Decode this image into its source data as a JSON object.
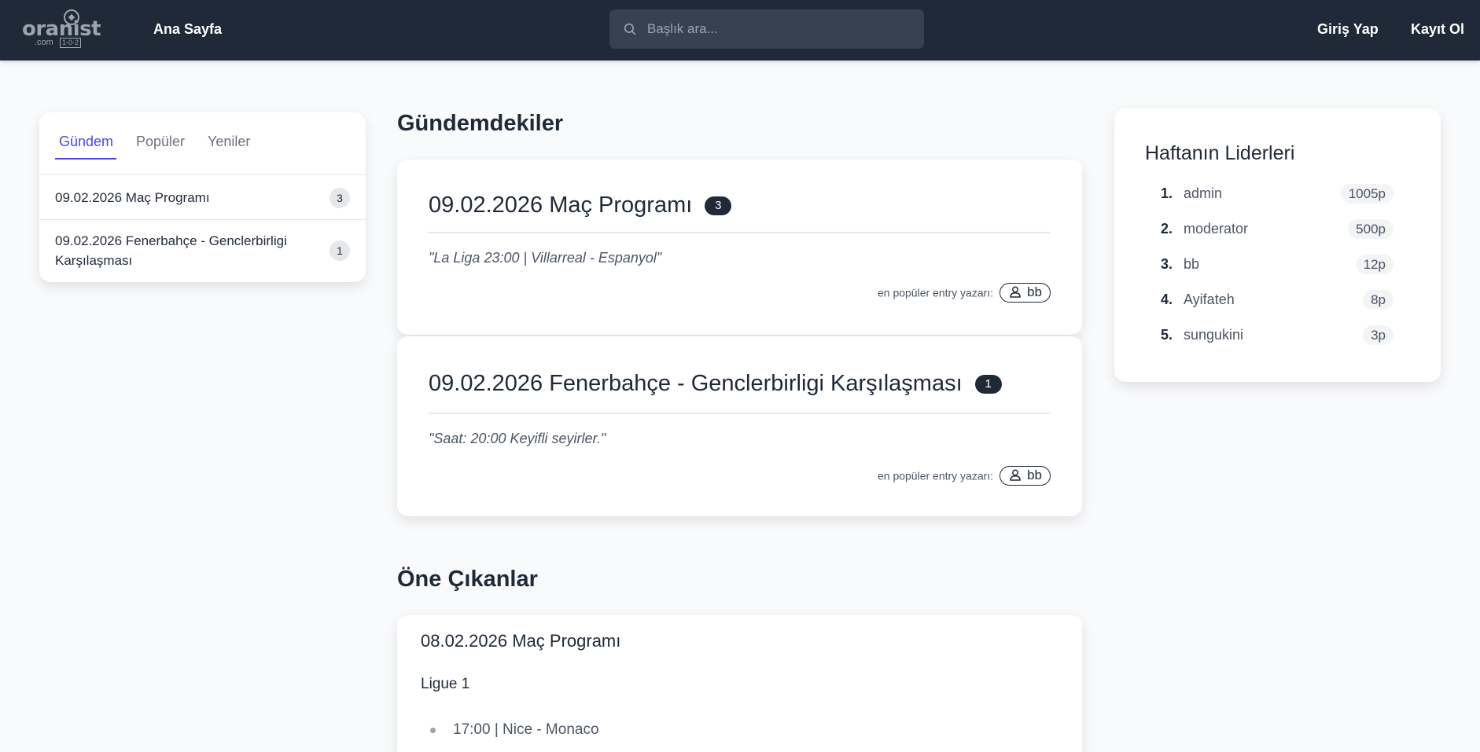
{
  "header": {
    "logo_brand": "oranist",
    "logo_domain": ".com",
    "logo_score": "1-0-2",
    "nav_home": "Ana Sayfa",
    "search_placeholder": "Başlık ara...",
    "login": "Giriş Yap",
    "register": "Kayıt Ol"
  },
  "sidebar": {
    "tabs": [
      {
        "label": "Gündem",
        "active": true
      },
      {
        "label": "Popüler",
        "active": false
      },
      {
        "label": "Yeniler",
        "active": false
      }
    ],
    "items": [
      {
        "title": "09.02.2026 Maç Programı",
        "count": "3"
      },
      {
        "title": "09.02.2026 Fenerbahçe - Genclerbirligi Karşılaşması",
        "count": "1"
      }
    ]
  },
  "main": {
    "section_title": "Gündemdekiler",
    "posts": [
      {
        "title": "09.02.2026 Maç Programı",
        "count": "3",
        "quote": "\"La Liga 23:00 | Villarreal - Espanyol\"",
        "author_label": "en popüler entry yazarı:",
        "author": "bb"
      },
      {
        "title": "09.02.2026 Fenerbahçe - Genclerbirligi Karşılaşması",
        "count": "1",
        "quote": "\"Saat: 20:00 Keyifli seyirler.\"",
        "author_label": "en popüler entry yazarı:",
        "author": "bb"
      }
    ],
    "featured_title": "Öne Çıkanlar",
    "featured": {
      "title": "08.02.2026 Maç Programı",
      "league": "Ligue 1",
      "items": [
        "17:00 | Nice - Monaco"
      ]
    }
  },
  "leaders": {
    "title": "Haftanın Liderleri",
    "items": [
      {
        "rank": "1.",
        "name": "admin",
        "points": "1005p"
      },
      {
        "rank": "2.",
        "name": "moderator",
        "points": "500p"
      },
      {
        "rank": "3.",
        "name": "bb",
        "points": "12p"
      },
      {
        "rank": "4.",
        "name": "Ayifateh",
        "points": "8p"
      },
      {
        "rank": "5.",
        "name": "sungukini",
        "points": "3p"
      }
    ]
  },
  "colors": {
    "navbar": "#1f2937",
    "accent": "#4f46e5",
    "badge": "#1f2937"
  },
  "icons": {
    "search": "search-icon",
    "author": "user-icon",
    "logo": "soccer-ball-icon"
  }
}
